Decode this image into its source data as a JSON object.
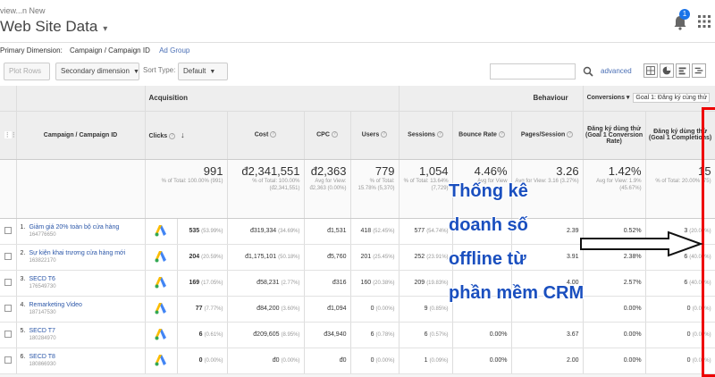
{
  "header": {
    "account": "view...n New",
    "view_title": "Web Site Data",
    "notification_count": "1",
    "accent": "#1a73e8"
  },
  "dimension": {
    "label": "Primary Dimension:",
    "active": "Campaign / Campaign ID",
    "other": "Ad Group"
  },
  "toolbar": {
    "plot_rows": "Plot Rows",
    "secondary_dimension": "Secondary dimension",
    "sort_type_label": "Sort Type:",
    "sort_type_value": "Default",
    "advanced": "advanced",
    "icons": [
      "search-icon",
      "table-view-icon",
      "pie-view-icon",
      "performance-view-icon",
      "comparison-view-icon"
    ]
  },
  "table": {
    "group_acquisition": "Acquisition",
    "group_behaviour": "Behaviour",
    "group_conversions": "Conversions",
    "goal_select": "Goal 1: Đăng ký cùng thử",
    "columns": {
      "campaign": "Campaign / Campaign ID",
      "clicks": "Clicks",
      "cost": "Cost",
      "cpc": "CPC",
      "users": "Users",
      "sessions": "Sessions",
      "bounce": "Bounce Rate",
      "pages": "Pages/Session",
      "conv_rate": "Đăng ký dùng thử (Goal 1 Conversion Rate)",
      "completions": "Đăng ký dùng thử (Goal 1 Completions)"
    },
    "totals": {
      "clicks": "991",
      "clicks_sub": "% of Total: 100.00% (991)",
      "cost": "đ2,341,551",
      "cost_sub": "% of Total: 100.00% (đ2,341,551)",
      "cpc": "đ2,363",
      "cpc_sub": "Avg for View: đ2,363 (0.00%)",
      "users": "779",
      "users_sub": "% of Total: 15.78% (5,370)",
      "sessions": "1,054",
      "sessions_sub": "% of Total: 13.64% (7,729)",
      "bounce": "4.46%",
      "bounce_sub": "Avg for View",
      "pages": "3.26",
      "pages_sub": "Avg for View: 3.16 (3.27%)",
      "conv_rate": "1.42%",
      "conv_rate_sub": "Avg for View: 1.9% (45.67%)",
      "completions": "15",
      "completions_sub": "% of Total: 20.00% (75)"
    },
    "rows": [
      {
        "num": "1.",
        "name": "Giảm giá 20% toàn bộ cửa hàng",
        "id": "164776650",
        "clicks": "535",
        "clicks_pct": "(53.99%)",
        "cost": "đ319,334",
        "cost_pct": "(34.69%)",
        "cpc": "đ1,531",
        "users": "418",
        "users_pct": "(52.45%)",
        "sessions": "577",
        "sessions_pct": "(54.74%)",
        "bounce": "",
        "pages": "2.39",
        "conv_rate": "0.52%",
        "completions": "3",
        "completions_pct": "(20.00%)"
      },
      {
        "num": "2.",
        "name": "Sự kiện khai trương cửa hàng mới",
        "id": "163822170",
        "clicks": "204",
        "clicks_pct": "(20.59%)",
        "cost": "đ1,175,101",
        "cost_pct": "(50.18%)",
        "cpc": "đ5,760",
        "users": "201",
        "users_pct": "(25.45%)",
        "sessions": "252",
        "sessions_pct": "(23.91%)",
        "bounce": "",
        "pages": "3.91",
        "conv_rate": "2.38%",
        "completions": "6",
        "completions_pct": "(40.00%)"
      },
      {
        "num": "3.",
        "name": "SECD T6",
        "id": "176549730",
        "clicks": "169",
        "clicks_pct": "(17.05%)",
        "cost": "đ58,231",
        "cost_pct": "(2.77%)",
        "cpc": "đ316",
        "users": "160",
        "users_pct": "(20.38%)",
        "sessions": "209",
        "sessions_pct": "(19.83%)",
        "bounce": "",
        "pages": "4.00",
        "conv_rate": "2.57%",
        "completions": "6",
        "completions_pct": "(40.00%)"
      },
      {
        "num": "4.",
        "name": "Remarketing Video",
        "id": "187147530",
        "clicks": "77",
        "clicks_pct": "(7.77%)",
        "cost": "đ84,200",
        "cost_pct": "(3.60%)",
        "cpc": "đ1,094",
        "users": "0",
        "users_pct": "(0.00%)",
        "sessions": "9",
        "sessions_pct": "(0.85%)",
        "bounce": "",
        "pages": "",
        "conv_rate": "0.00%",
        "completions": "0",
        "completions_pct": "(0.00%)"
      },
      {
        "num": "5.",
        "name": "SECD T7",
        "id": "180284970",
        "clicks": "6",
        "clicks_pct": "(0.61%)",
        "cost": "đ209,605",
        "cost_pct": "(8.95%)",
        "cpc": "đ34,940",
        "users": "6",
        "users_pct": "(0.78%)",
        "sessions": "6",
        "sessions_pct": "(0.57%)",
        "bounce": "0.00%",
        "pages": "3.67",
        "conv_rate": "0.00%",
        "completions": "0",
        "completions_pct": "(0.00%)"
      },
      {
        "num": "6.",
        "name": "SECD T8",
        "id": "180866930",
        "clicks": "0",
        "clicks_pct": "(0.00%)",
        "cost": "đ0",
        "cost_pct": "(0.00%)",
        "cpc": "đ0",
        "users": "0",
        "users_pct": "(0.00%)",
        "sessions": "1",
        "sessions_pct": "(0.09%)",
        "bounce": "0.00%",
        "pages": "2.00",
        "conv_rate": "0.00%",
        "completions": "0",
        "completions_pct": "(0.00%)"
      }
    ]
  },
  "annotation": {
    "lines": [
      "Thống kê",
      "doanh số",
      "offline từ",
      "phần mềm CRM"
    ],
    "text_color": "#1a4fbf",
    "box_color": "#e00000"
  }
}
